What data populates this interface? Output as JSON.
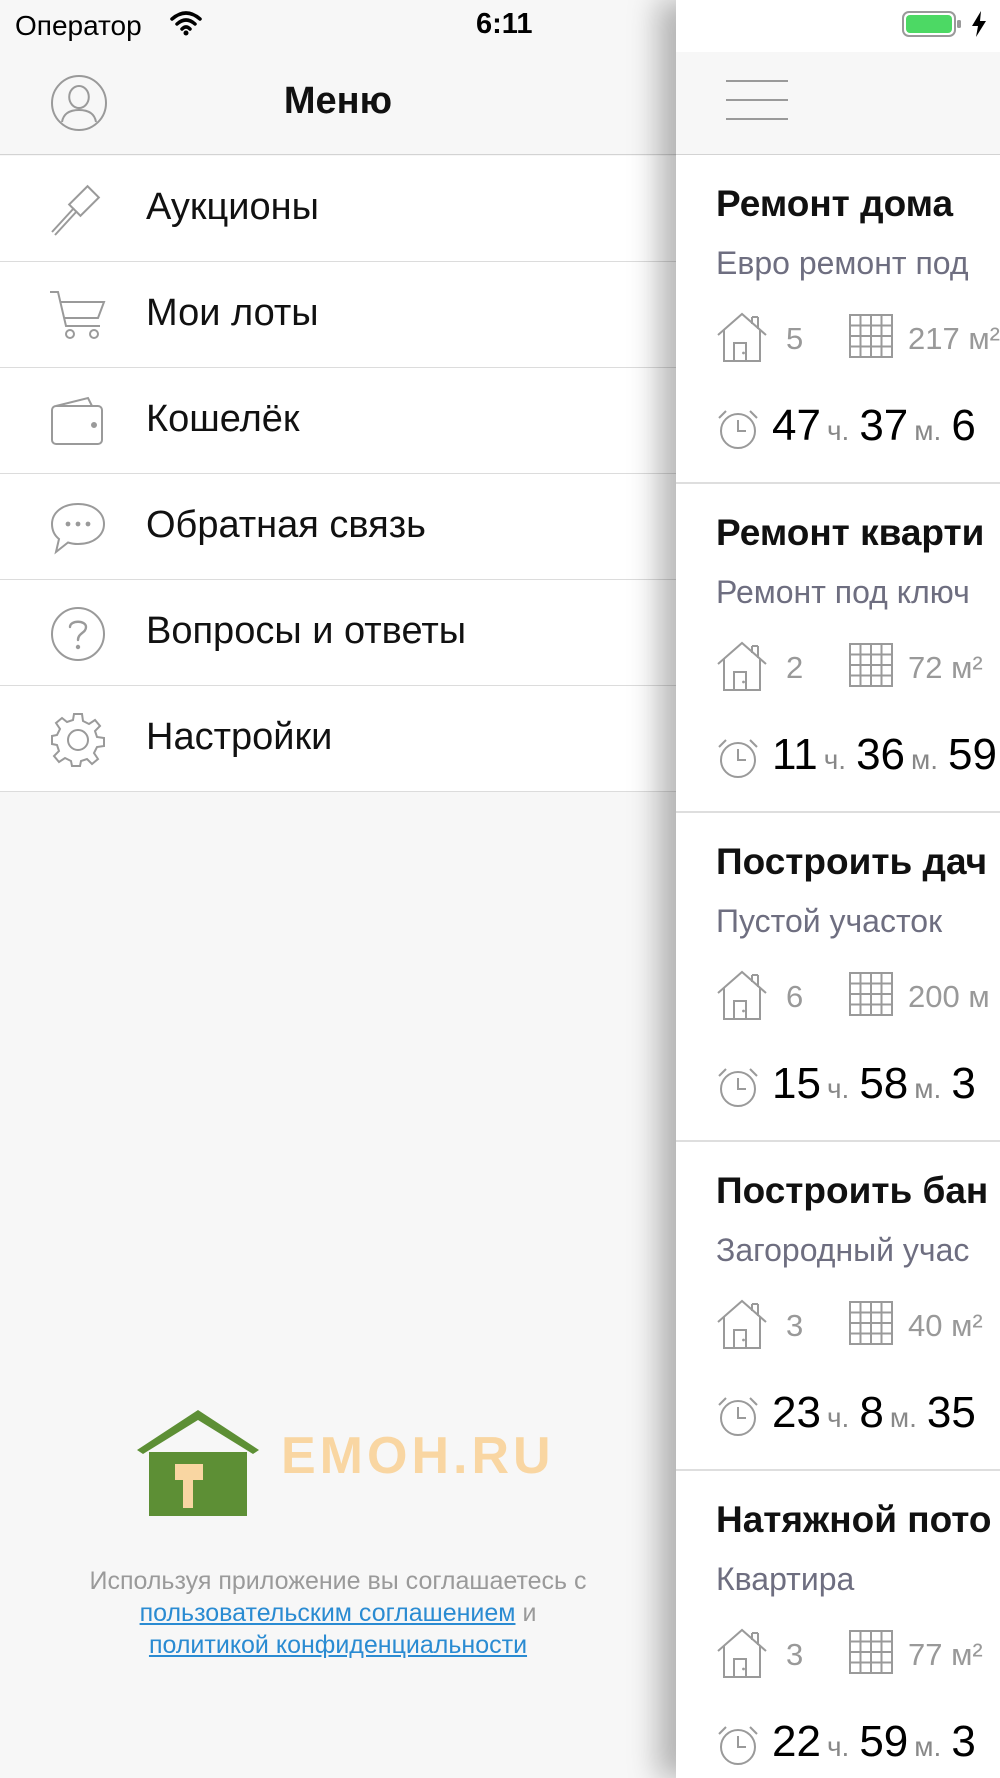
{
  "status_bar": {
    "carrier": "Оператор",
    "time": "6:11",
    "battery_color": "#4cd964"
  },
  "menu": {
    "title": "Меню",
    "items": [
      {
        "label": "Аукционы",
        "icon": "gavel-icon"
      },
      {
        "label": "Мои лоты",
        "icon": "cart-icon"
      },
      {
        "label": "Кошелёк",
        "icon": "wallet-icon"
      },
      {
        "label": "Обратная связь",
        "icon": "chat-icon"
      },
      {
        "label": "Вопросы и ответы",
        "icon": "question-icon"
      },
      {
        "label": "Настройки",
        "icon": "gear-icon"
      }
    ]
  },
  "logo": {
    "text": "EMOH.RU",
    "house_color": "#5d8f35",
    "text_color": "#f9d6a2"
  },
  "footer": {
    "text": "Используя приложение вы соглашаетесь с",
    "terms_link": "пользовательским соглашением",
    "conjunction": "и",
    "privacy_link": "политикой конфиденциальности",
    "link_color": "#2a8bd2"
  },
  "lots": [
    {
      "title": "Ремонт дома",
      "subtitle": "Евро ремонт под",
      "rooms": "5",
      "area": "217 м²",
      "hours": "47",
      "minutes": "37",
      "seconds": "6"
    },
    {
      "title": "Ремонт кварти",
      "subtitle": "Ремонт под ключ",
      "rooms": "2",
      "area": "72 м²",
      "hours": "11",
      "minutes": "36",
      "seconds": "59"
    },
    {
      "title": "Построить дач",
      "subtitle": "Пустой участок",
      "rooms": "6",
      "area": "200 м",
      "hours": "15",
      "minutes": "58",
      "seconds": "3"
    },
    {
      "title": "Построить бан",
      "subtitle": "Загородный учас",
      "rooms": "3",
      "area": "40 м²",
      "hours": "23",
      "minutes": "8",
      "seconds": "35"
    },
    {
      "title": "Натяжной пото",
      "subtitle": "Квартира",
      "rooms": "3",
      "area": "77 м²",
      "hours": "22",
      "minutes": "59",
      "seconds": "3"
    }
  ],
  "timer_units": {
    "hours": "ч.",
    "minutes": "м."
  }
}
